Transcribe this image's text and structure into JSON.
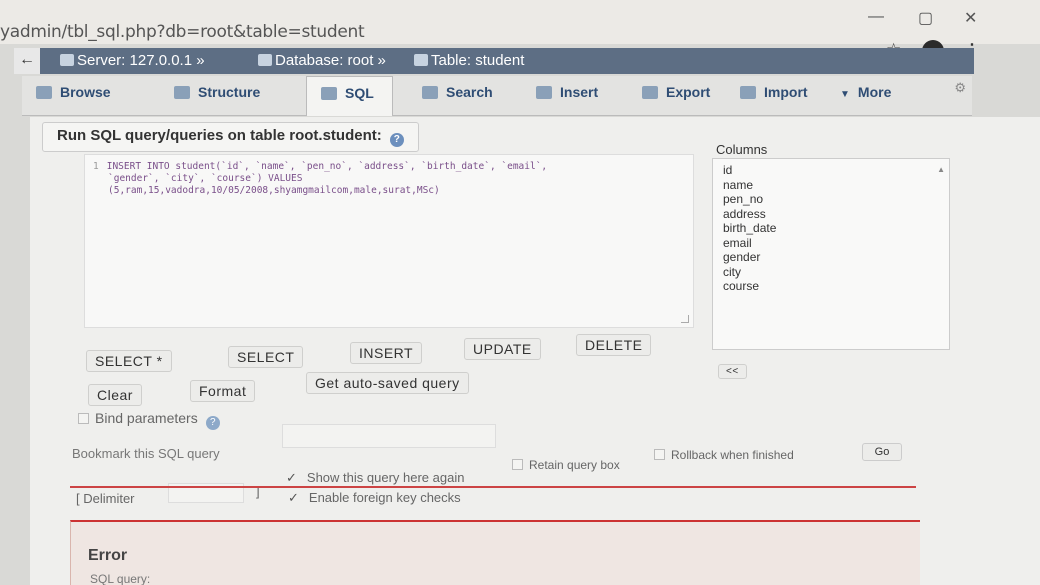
{
  "browser": {
    "url": "yadmin/tbl_sql.php?db=root&table=student",
    "minimize": "—",
    "restore": "▢",
    "close": "✕",
    "more": "⋮"
  },
  "breadcrumb": {
    "back": "←",
    "server": "Server: 127.0.0.1 »",
    "database": "Database: root »",
    "table": "Table: student"
  },
  "tabs": [
    {
      "label": "Browse"
    },
    {
      "label": "Structure"
    },
    {
      "label": "SQL"
    },
    {
      "label": "Search"
    },
    {
      "label": "Insert"
    },
    {
      "label": "Export"
    },
    {
      "label": "Import"
    },
    {
      "label": "More"
    }
  ],
  "panel": {
    "title": "Run SQL query/queries on table root.student:",
    "editor_lines": [
      {
        "num": "1",
        "text": "INSERT INTO student(`id`, `name`, `pen_no`, `address`, `birth_date`, `email`,"
      },
      {
        "num": "",
        "text": "`gender`, `city`, `course`) VALUES"
      },
      {
        "num": "",
        "text": "(5,ram,15,vadodra,10/05/2008,shyamgmailcom,male,surat,MSc)"
      }
    ],
    "columns_title": "Columns",
    "columns": [
      "id",
      "name",
      "pen_no",
      "address",
      "birth_date",
      "email",
      "gender",
      "city",
      "course"
    ]
  },
  "buttons": {
    "select_star": "SELECT *",
    "select": "SELECT",
    "insert": "INSERT",
    "update": "UPDATE",
    "delete": "DELETE",
    "clear": "Clear",
    "format": "Format",
    "autosaved": "Get auto-saved query",
    "insert_column": "<<",
    "go": "Go"
  },
  "options": {
    "bind_parameters": "Bind parameters",
    "bookmark": "Bookmark this SQL query",
    "delimiter_open": "[ Delimiter",
    "delimiter_close": "]",
    "show_query": "Show this query here again",
    "retain_box": "Retain query box",
    "rollback": "Rollback when finished",
    "foreign_keys": "Enable foreign key checks",
    "tick": "✓"
  },
  "error": {
    "title": "Error",
    "sub": "SQL query:"
  }
}
